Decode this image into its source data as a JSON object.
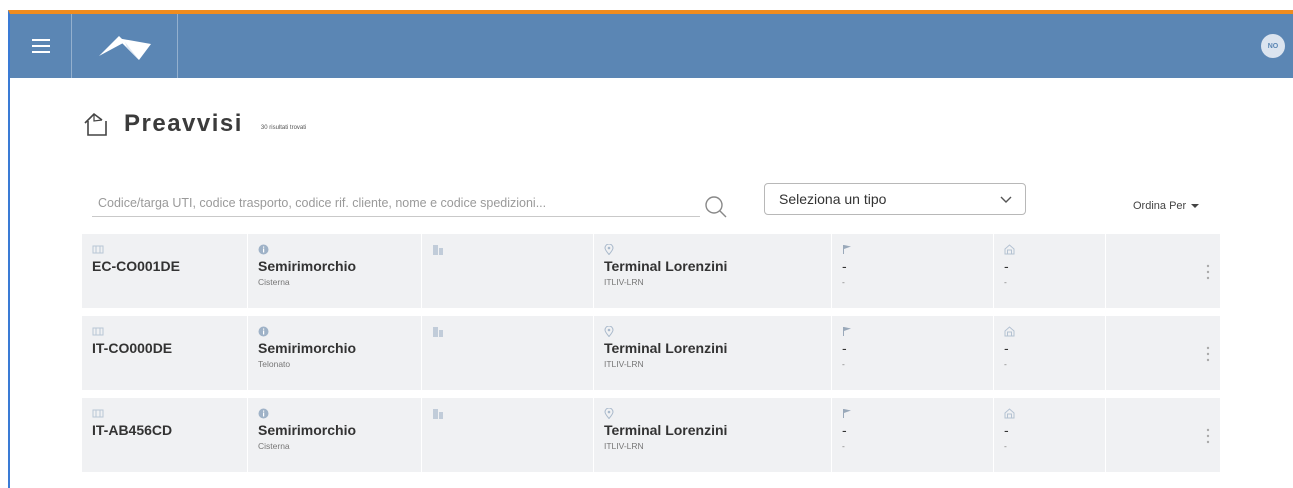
{
  "header": {
    "avatar_initials": "NO"
  },
  "page": {
    "title": "Preavvisi",
    "results_label": "30 risultati trovati"
  },
  "filters": {
    "search_placeholder": "Codice/targa UTI, codice trasporto, codice rif. cliente, nome e codice spedizioni...",
    "type_select_value": "Seleziona un tipo",
    "sort_label": "Ordina Per"
  },
  "rows": [
    {
      "uti_code": "EC-CO001DE",
      "vehicle_type": "Semirimorchio",
      "vehicle_subtype": "Cisterna",
      "terminal_name": "Terminal Lorenzini",
      "terminal_code": "ITLIV-LRN",
      "flag_value": "-",
      "flag_sub": "-",
      "dest_value": "-",
      "dest_sub": "-"
    },
    {
      "uti_code": "IT-CO000DE",
      "vehicle_type": "Semirimorchio",
      "vehicle_subtype": "Telonato",
      "terminal_name": "Terminal Lorenzini",
      "terminal_code": "ITLIV-LRN",
      "flag_value": "-",
      "flag_sub": "-",
      "dest_value": "-",
      "dest_sub": "-"
    },
    {
      "uti_code": "IT-AB456CD",
      "vehicle_type": "Semirimorchio",
      "vehicle_subtype": "Cisterna",
      "terminal_name": "Terminal Lorenzini",
      "terminal_code": "ITLIV-LRN",
      "flag_value": "-",
      "flag_sub": "-",
      "dest_value": "-",
      "dest_sub": "-"
    }
  ],
  "colors": {
    "appbar": "#5b86b4",
    "top_accent": "#f08c1e",
    "row_background": "#f0f1f3"
  }
}
